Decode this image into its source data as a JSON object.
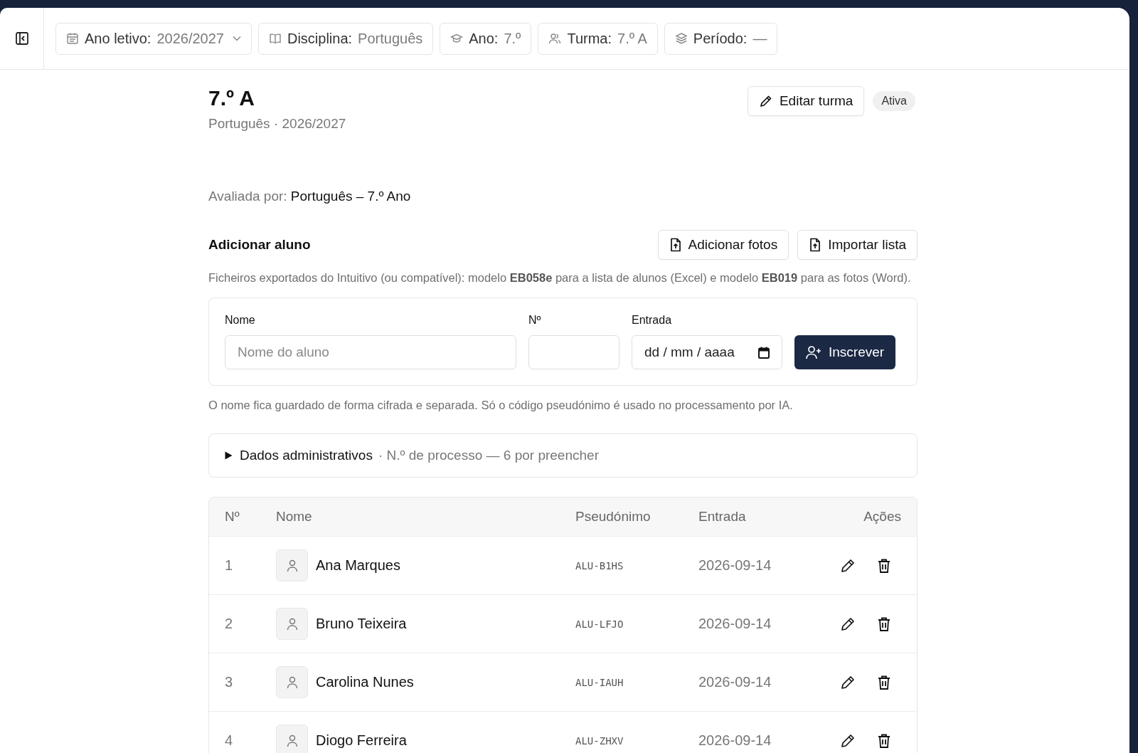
{
  "filters": [
    {
      "kind": "year",
      "label": "Ano letivo:",
      "value": "2026/2027",
      "dropdown": true
    },
    {
      "kind": "subject",
      "label": "Disciplina:",
      "value": "Português",
      "dropdown": false
    },
    {
      "kind": "grade",
      "label": "Ano:",
      "value": "7.º",
      "dropdown": false
    },
    {
      "kind": "class",
      "label": "Turma:",
      "value": "7.º A",
      "dropdown": false
    },
    {
      "kind": "period",
      "label": "Período:",
      "value": "—",
      "dropdown": false
    }
  ],
  "class_header": {
    "title": "7.º A",
    "subtitle": "Português · 2026/2027",
    "edit_button": "Editar turma",
    "status_badge": "Ativa"
  },
  "evaluated_by": {
    "label": "Avaliada por:",
    "value": "Português – 7.º Ano"
  },
  "add_student": {
    "title": "Adicionar aluno",
    "buttons": [
      "Adicionar fotos",
      "Importar lista"
    ],
    "hint": "Ficheiros exportados do Intuitivo (ou compatível): modelo **EB058e** para a lista de alunos (Excel) e modelo **EB019** para as fotos (Word).",
    "fields": [
      {
        "kind": "text",
        "label": "Nome",
        "placeholder": "Nome do aluno"
      },
      {
        "kind": "number",
        "label": "Nº"
      },
      {
        "kind": "date",
        "label": "Entrada",
        "placeholder": "dd / mm / aaaa"
      }
    ],
    "submit": "Inscrever",
    "note": "O nome fica guardado de forma cifrada e separada. Só o código pseudónimo é usado no processamento por IA."
  },
  "admin_details": {
    "expanded": false,
    "title": "Dados administrativos",
    "summary": "· N.º de processo — 6 por preencher"
  },
  "table": {
    "columns": [
      "Nº",
      "Nome",
      "Pseudónimo",
      "Entrada",
      "Ações"
    ],
    "rows": [
      {
        "number": "1",
        "name": "Ana Marques",
        "pseudonym": "ALU-B1HS",
        "entry": "2026-09-14"
      },
      {
        "number": "2",
        "name": "Bruno Teixeira",
        "pseudonym": "ALU-LFJO",
        "entry": "2026-09-14"
      },
      {
        "number": "3",
        "name": "Carolina Nunes",
        "pseudonym": "ALU-IAUH",
        "entry": "2026-09-14"
      },
      {
        "number": "4",
        "name": "Diogo Ferreira",
        "pseudonym": "ALU-ZHXV",
        "entry": "2026-09-14"
      }
    ]
  }
}
